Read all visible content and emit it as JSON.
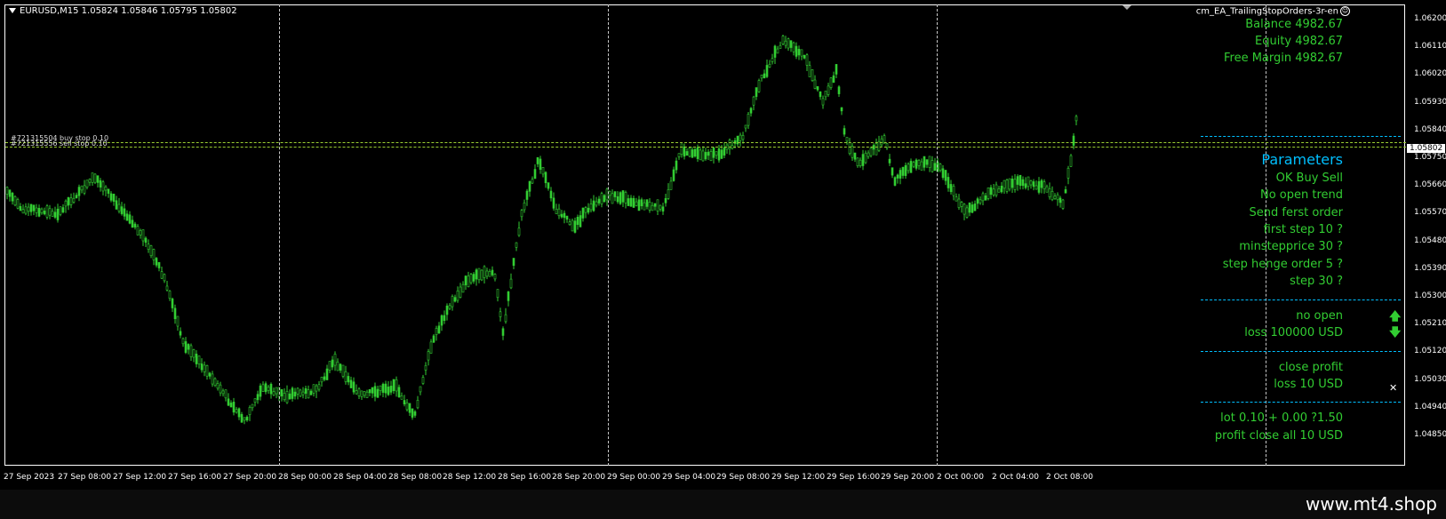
{
  "chart": {
    "symbol_header": "EURUSD,M15  1.05824 1.05846 1.05795 1.05802",
    "ea_name": "cm_EA_TrailingStopOrders-3r-en",
    "current_price": "1.05802",
    "price_axis": [
      "1.06200",
      "1.06110",
      "1.06020",
      "1.05930",
      "1.05840",
      "1.05750",
      "1.05660",
      "1.05570",
      "1.05480",
      "1.05390",
      "1.05300",
      "1.05210",
      "1.05120",
      "1.05030",
      "1.04940",
      "1.04850"
    ],
    "time_axis": [
      "27 Sep 2023",
      "27 Sep 08:00",
      "27 Sep 12:00",
      "27 Sep 16:00",
      "27 Sep 20:00",
      "28 Sep 00:00",
      "28 Sep 04:00",
      "28 Sep 08:00",
      "28 Sep 12:00",
      "28 Sep 16:00",
      "28 Sep 20:00",
      "29 Sep 00:00",
      "29 Sep 04:00",
      "29 Sep 08:00",
      "29 Sep 12:00",
      "29 Sep 16:00",
      "29 Sep 20:00",
      "2 Oct 00:00",
      "2 Oct 04:00",
      "2 Oct 08:00"
    ],
    "order_labels": [
      "#721315504 buy stop 0.10",
      "#721315556 sell stop 0.10"
    ],
    "colors": {
      "candle": "#32cd32",
      "panel_text": "#32cd32",
      "title": "#00bfff",
      "background": "#000000"
    }
  },
  "account": {
    "balance": "Balance 4982.67",
    "equity": "Equity 4982.67",
    "free_margin": "Free Margin 4982.67"
  },
  "panel": {
    "title": "Parameters",
    "lines": [
      "OK Buy Sell",
      "No open trend",
      "Send ferst order",
      "first step 10 ?",
      "minstepprice 30 ?",
      "step henge order 5 ?",
      "step  30 ?"
    ],
    "status_open": "no open",
    "status_loss": "loss 100000 USD",
    "close_profit": "close profit",
    "close_loss": "loss 10 USD",
    "lot_line": "lot 0.10 + 0.00 ?1.50",
    "profit_close": "profit close all 10 USD"
  },
  "footer": {
    "site": "www.mt4.shop"
  }
}
